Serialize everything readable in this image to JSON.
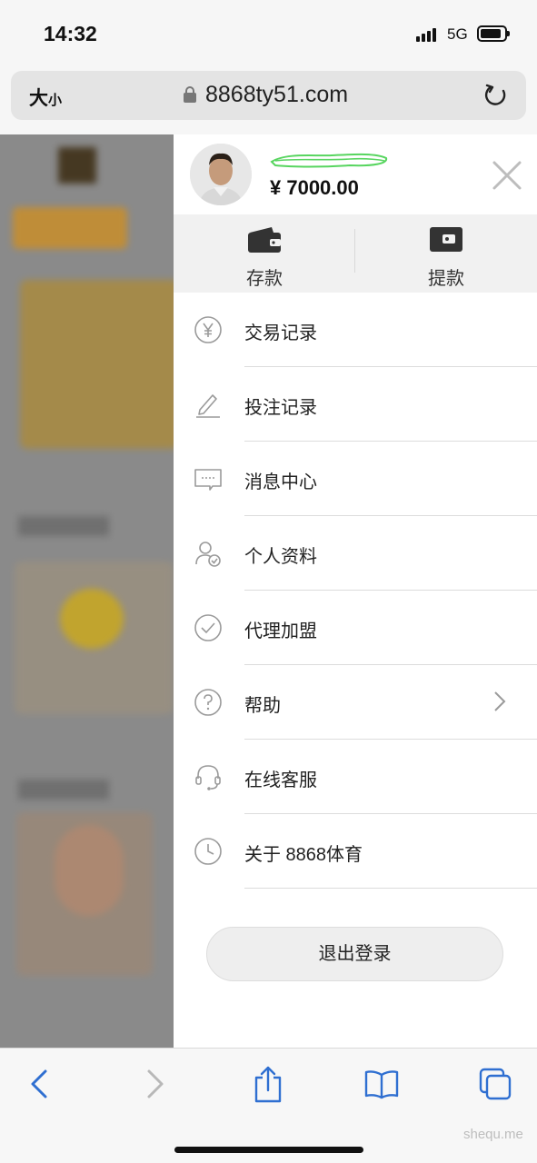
{
  "status_bar": {
    "time": "14:32",
    "network": "5G"
  },
  "browser": {
    "text_size_label": "大",
    "text_size_small": "小",
    "url": "8868ty51.com"
  },
  "drawer": {
    "balance": "¥ 7000.00",
    "actions": [
      {
        "label": "存款",
        "icon": "wallet-icon"
      },
      {
        "label": "提款",
        "icon": "withdraw-wallet-icon"
      }
    ],
    "menu": [
      {
        "label": "交易记录",
        "icon": "yuan-circle-icon"
      },
      {
        "label": "投注记录",
        "icon": "pencil-icon"
      },
      {
        "label": "消息中心",
        "icon": "message-icon"
      },
      {
        "label": "个人资料",
        "icon": "user-check-icon"
      },
      {
        "label": "代理加盟",
        "icon": "check-circle-icon"
      },
      {
        "label": "帮助",
        "icon": "question-circle-icon"
      },
      {
        "label": "在线客服",
        "icon": "headset-icon"
      },
      {
        "label": "关于 8868体育",
        "icon": "clock-icon"
      }
    ],
    "logout_label": "退出登录"
  },
  "watermark": "shequ.me",
  "colors": {
    "accent": "#111111",
    "drawer_bg": "#ffffff",
    "action_bg": "#f1f1f1",
    "ios_blue": "#2f6fd1"
  }
}
